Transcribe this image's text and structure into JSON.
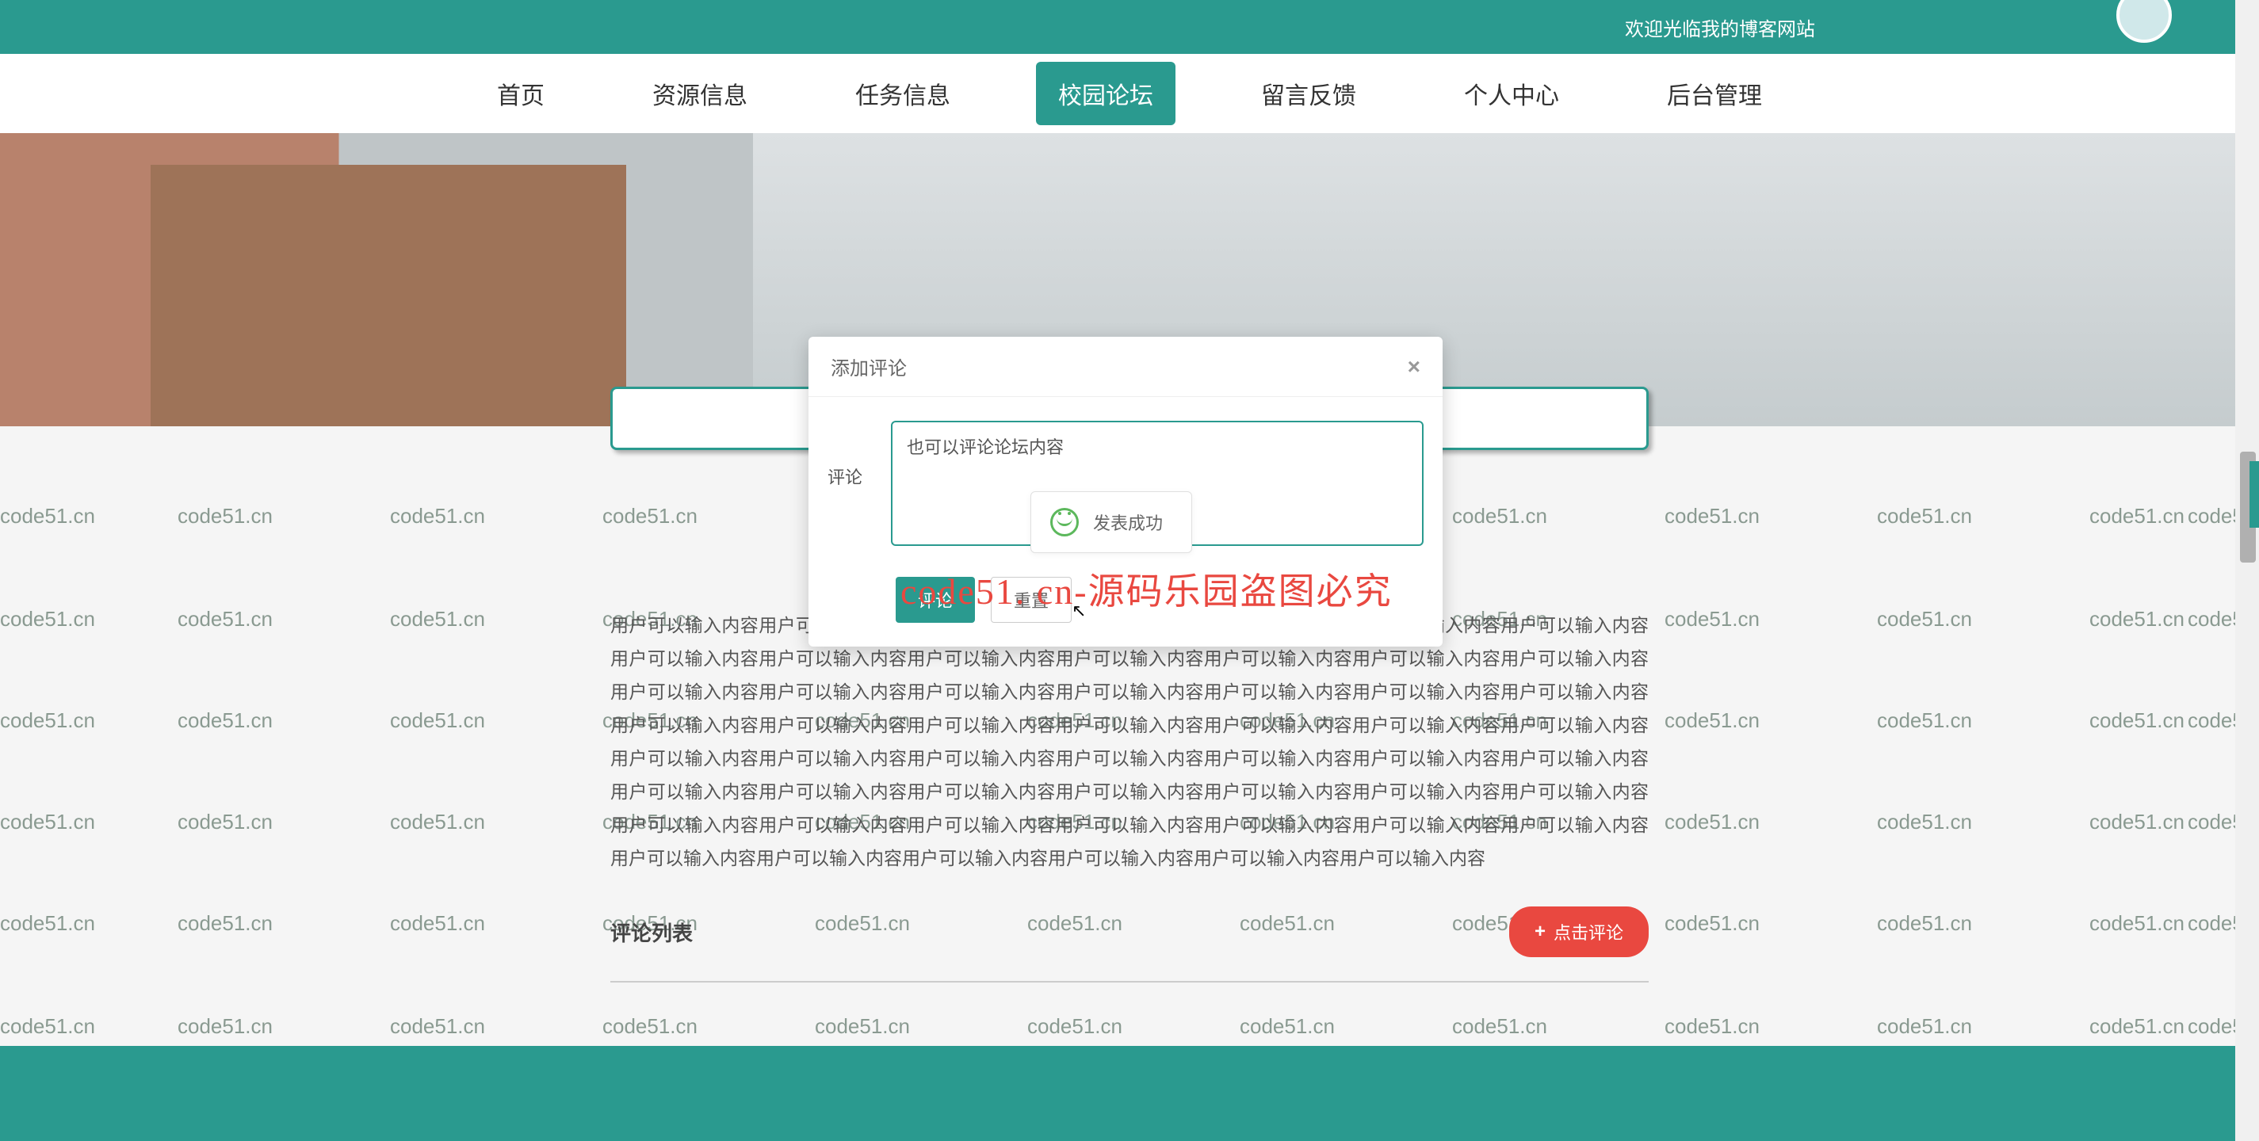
{
  "watermark": "code51.cn",
  "header": {
    "welcome": "欢迎光临我的博客网站"
  },
  "nav": {
    "items": [
      {
        "label": "首页",
        "active": false
      },
      {
        "label": "资源信息",
        "active": false
      },
      {
        "label": "任务信息",
        "active": false
      },
      {
        "label": "校园论坛",
        "active": true
      },
      {
        "label": "留言反馈",
        "active": false
      },
      {
        "label": "个人中心",
        "active": false
      },
      {
        "label": "后台管理",
        "active": false
      }
    ]
  },
  "content": {
    "body_text": "用户可以输入内容用户可以输入内容用户可以输入内容用户可以输入内容用户可以输入内容用户可以输入内容用户可以输入内容用户可以输入内容用户可以输入内容用户可以输入内容用户可以输入内容用户可以输入内容用户可以输入内容用户可以输入内容用户可以输入内容用户可以输入内容用户可以输入内容用户可以输入内容用户可以输入内容用户可以输入内容用户可以输入内容用户可以输入内容用户可以输入内容用户可以输入内容用户可以输入内容用户可以输入内容用户可以输入内容用户可以输入内容用户可以输入内容用户可以输入内容用户可以输入内容用户可以输入内容用户可以输入内容用户可以输入内容用户可以输入内容用户可以输入内容用户可以输入内容用户可以输入内容用户可以输入内容用户可以输入内容用户可以输入内容用户可以输入内容用户可以输入内容用户可以输入内容用户可以输入内容用户可以输入内容用户可以输入内容用户可以输入内容用户可以输入内容用户可以输入内容用户可以输入内容用户可以输入内容用户可以输入内容用户可以输入内容用户可以输入内容",
    "section_title": "评论列表",
    "comment_button": "点击评论"
  },
  "modal": {
    "title": "添加评论",
    "field_label": "评论",
    "textarea_value": "也可以评论论坛内容",
    "submit_label": "评论",
    "reset_label": "重置"
  },
  "toast": {
    "message": "发表成功"
  },
  "overlay": {
    "red_text": "code51. cn-源码乐园盗图必究"
  }
}
